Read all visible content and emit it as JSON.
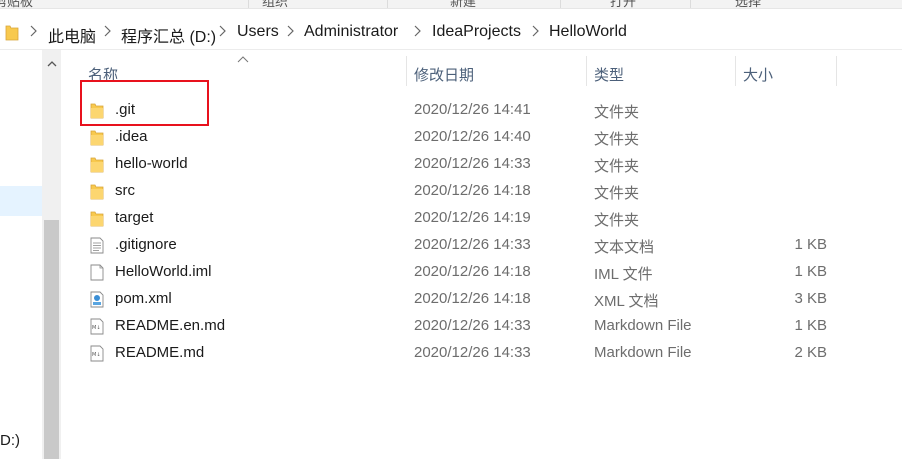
{
  "ribbon": {
    "items": [
      "组织",
      "新建",
      "打开",
      "选择"
    ],
    "left_label": "剪贴板"
  },
  "address": {
    "segments": [
      "此电脑",
      "程序汇总 (D:)",
      "Users",
      "Administrator",
      "IdeaProjects",
      "HelloWorld"
    ]
  },
  "nav": {
    "drive_label": "D:)"
  },
  "columns": {
    "name": "名称",
    "date": "修改日期",
    "type": "类型",
    "size": "大小"
  },
  "files": [
    {
      "name": ".git",
      "date": "2020/12/26 14:41",
      "type": "文件夹",
      "size": "",
      "icon": "folder-icon"
    },
    {
      "name": ".idea",
      "date": "2020/12/26 14:40",
      "type": "文件夹",
      "size": "",
      "icon": "folder-icon"
    },
    {
      "name": "hello-world",
      "date": "2020/12/26 14:33",
      "type": "文件夹",
      "size": "",
      "icon": "folder-icon"
    },
    {
      "name": "src",
      "date": "2020/12/26 14:18",
      "type": "文件夹",
      "size": "",
      "icon": "folder-icon"
    },
    {
      "name": "target",
      "date": "2020/12/26 14:19",
      "type": "文件夹",
      "size": "",
      "icon": "folder-icon"
    },
    {
      "name": ".gitignore",
      "date": "2020/12/26 14:33",
      "type": "文本文档",
      "size": "1 KB",
      "icon": "text-file-icon"
    },
    {
      "name": "HelloWorld.iml",
      "date": "2020/12/26 14:18",
      "type": "IML 文件",
      "size": "1 KB",
      "icon": "blank-file-icon"
    },
    {
      "name": "pom.xml",
      "date": "2020/12/26 14:18",
      "type": "XML 文档",
      "size": "3 KB",
      "icon": "xml-file-icon"
    },
    {
      "name": "README.en.md",
      "date": "2020/12/26 14:33",
      "type": "Markdown File",
      "size": "1 KB",
      "icon": "markdown-file-icon"
    },
    {
      "name": "README.md",
      "date": "2020/12/26 14:33",
      "type": "Markdown File",
      "size": "2 KB",
      "icon": "markdown-file-icon"
    }
  ],
  "colors": {
    "highlight": "#e8111d",
    "folder": "#f8c94e",
    "header_text": "#4c607a",
    "selection": "#e5f3ff"
  }
}
